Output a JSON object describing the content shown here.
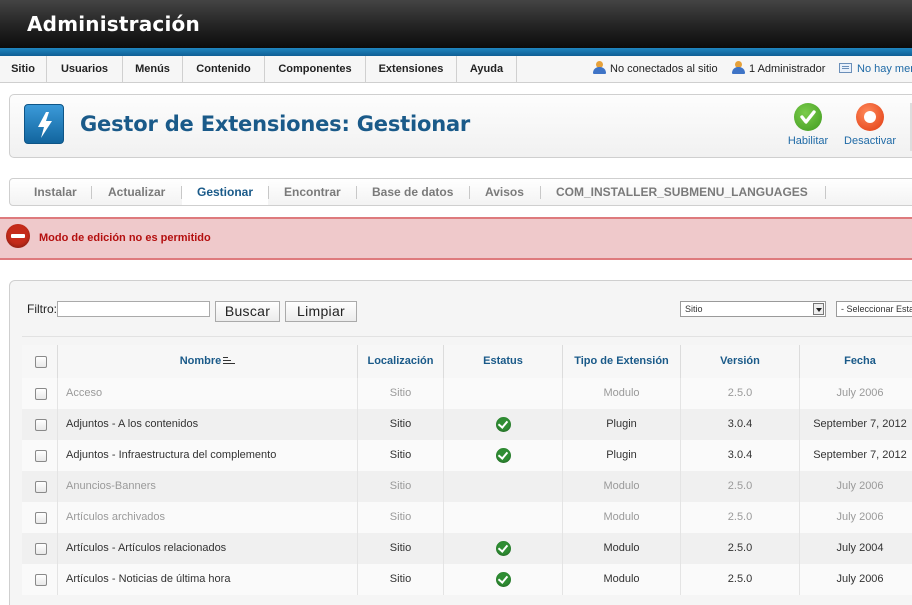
{
  "header": {
    "title": "Administración"
  },
  "menu": {
    "items": [
      {
        "label": "Sitio"
      },
      {
        "label": "Usuarios"
      },
      {
        "label": "Menús"
      },
      {
        "label": "Contenido"
      },
      {
        "label": "Componentes"
      },
      {
        "label": "Extensiones"
      },
      {
        "label": "Ayuda"
      }
    ],
    "status": {
      "offline": "No conectados al sitio",
      "admins": "1 Administrador",
      "messages": "No hay mensajes"
    }
  },
  "toolbar": {
    "title": "Gestor de Extensiones: Gestionar",
    "enable_label": "Habilitar",
    "disable_label": "Desactivar"
  },
  "submenu": {
    "items": [
      {
        "label": "Instalar"
      },
      {
        "label": "Actualizar"
      },
      {
        "label": "Gestionar"
      },
      {
        "label": "Encontrar"
      },
      {
        "label": "Base de datos"
      },
      {
        "label": "Avisos"
      },
      {
        "label": "COM_INSTALLER_SUBMENU_LANGUAGES"
      }
    ],
    "active": "Gestionar"
  },
  "error": {
    "message": "Modo de edición no es permitido"
  },
  "filter": {
    "label": "Filtro:",
    "value": "",
    "search_button": "Buscar",
    "clear_button": "Limpiar",
    "location_select": "Sitio",
    "state_select": "- Seleccionar Estado -"
  },
  "table": {
    "columns": [
      "Nombre",
      "Localización",
      "Estatus",
      "Tipo de Extensión",
      "Versión",
      "Fecha"
    ],
    "rows": [
      {
        "name": "Acceso",
        "location": "Sitio",
        "enabled": false,
        "type": "Modulo",
        "version": "2.5.0",
        "date": "July 2006",
        "muted": true
      },
      {
        "name": "Adjuntos - A los contenidos",
        "location": "Sitio",
        "enabled": true,
        "type": "Plugin",
        "version": "3.0.4",
        "date": "September 7, 2012",
        "muted": false
      },
      {
        "name": "Adjuntos - Infraestructura del complemento",
        "location": "Sitio",
        "enabled": true,
        "type": "Plugin",
        "version": "3.0.4",
        "date": "September 7, 2012",
        "muted": false
      },
      {
        "name": "Anuncios-Banners",
        "location": "Sitio",
        "enabled": false,
        "type": "Modulo",
        "version": "2.5.0",
        "date": "July 2006",
        "muted": true
      },
      {
        "name": "Artículos archivados",
        "location": "Sitio",
        "enabled": false,
        "type": "Modulo",
        "version": "2.5.0",
        "date": "July 2006",
        "muted": true
      },
      {
        "name": "Artículos - Artículos relacionados",
        "location": "Sitio",
        "enabled": true,
        "type": "Modulo",
        "version": "2.5.0",
        "date": "July 2004",
        "muted": false
      },
      {
        "name": "Artículos - Noticias de última hora",
        "location": "Sitio",
        "enabled": true,
        "type": "Modulo",
        "version": "2.5.0",
        "date": "July 2006",
        "muted": false
      }
    ]
  },
  "colors": {
    "brand_blue": "#1a5a89",
    "header_stripe": "#1f86c0",
    "error_bg": "#efc9cb",
    "error_text": "#b40f0f",
    "enabled_green": "#2f8d33",
    "disable_red": "#e8431f"
  },
  "icons": {
    "extension": "lightning-icon",
    "enable": "check-circle-icon",
    "disable": "stop-circle-icon",
    "error": "no-entry-icon",
    "status_enabled": "check-circle-icon"
  }
}
